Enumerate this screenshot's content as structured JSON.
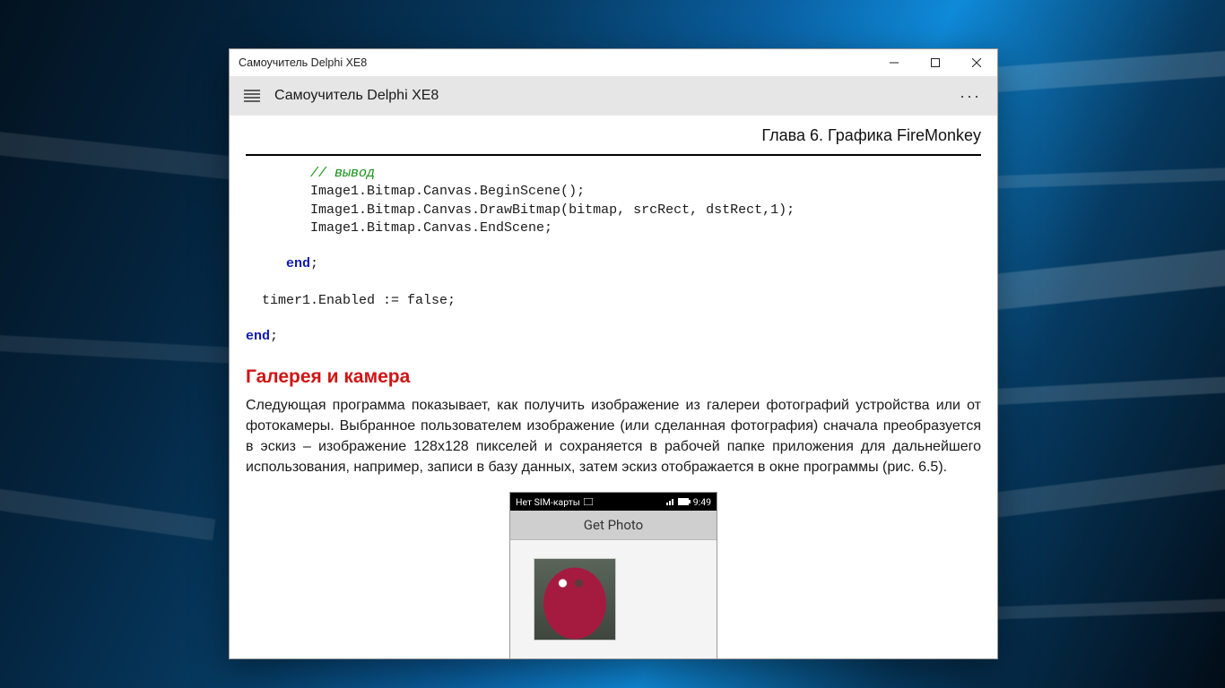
{
  "window": {
    "title": "Самоучитель Delphi XE8"
  },
  "toolbar": {
    "title": "Самоучитель Delphi XE8",
    "more": "···"
  },
  "chapter": "Глава 6. Графика FireMonkey",
  "code": {
    "comment": "// вывод",
    "line1": "Image1.Bitmap.Canvas.BeginScene();",
    "line2": "Image1.Bitmap.Canvas.DrawBitmap(bitmap, srcRect, dstRect,1);",
    "line3": "Image1.Bitmap.Canvas.EndScene;",
    "end1": "end",
    "semicolon1": ";",
    "line4": "timer1.Enabled := false;",
    "end2": "end",
    "semicolon2": ";"
  },
  "section_title": "Галерея и камера",
  "paragraph": "Следующая программа показывает, как получить изображение из галереи фотографий устройства или от фотокамеры. Выбранное пользователем изображение (или сделанная фотография) сначала преобразуется в эскиз – изображение 128x128 пикселей и сохраняется в рабочей папке приложения для дальнейшего использования, например, записи в базу данных, затем эскиз отображается в окне программы (рис. 6.5).",
  "phone": {
    "sim_text": "Нет SIM-карты",
    "time": "9:49",
    "header": "Get Photo"
  }
}
